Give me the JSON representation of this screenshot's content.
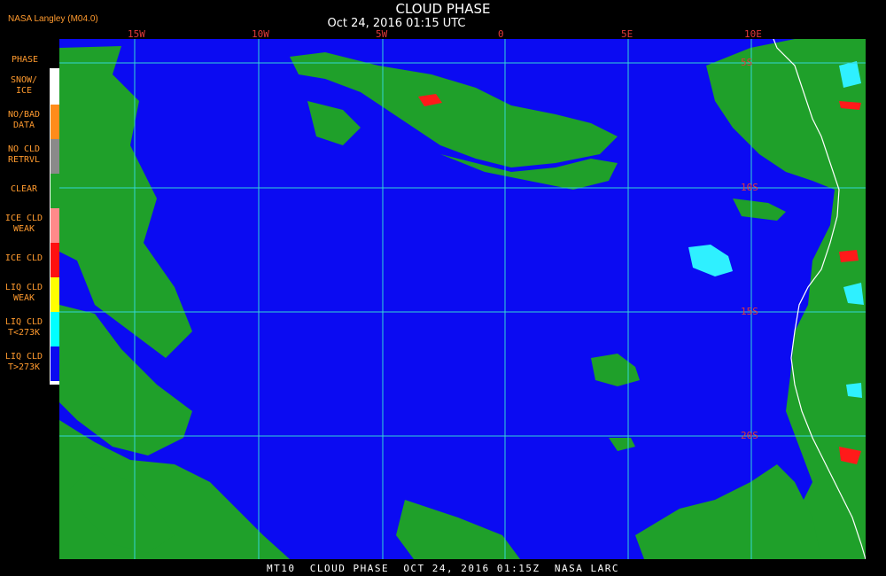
{
  "header": {
    "provider": "NASA Langley (M04.0)",
    "title": "CLOUD PHASE",
    "datetime": "Oct 24, 2016 01:15 UTC"
  },
  "legend": {
    "heading": "PHASE",
    "items": [
      {
        "label": "SNOW/\nICE",
        "color": "#ffffff"
      },
      {
        "label": "NO/BAD\nDATA",
        "color": "#ff8c1a"
      },
      {
        "label": "NO CLD\nRETRVL",
        "color": "#8a8a8a"
      },
      {
        "label": "CLEAR",
        "color": "#1fa02a"
      },
      {
        "label": "ICE CLD\nWEAK",
        "color": "#ff8a8a"
      },
      {
        "label": "ICE CLD",
        "color": "#ff1010"
      },
      {
        "label": "LIQ CLD\nWEAK",
        "color": "#ffff00"
      },
      {
        "label": "LIQ CLD\nT<273K",
        "color": "#00ffff"
      },
      {
        "label": "LIQ CLD\nT>273K",
        "color": "#0a0af0"
      }
    ]
  },
  "map": {
    "longitude_labels": [
      "15W",
      "10W",
      "5W",
      "0",
      "5E",
      "10E"
    ],
    "latitude_labels": [
      "5S",
      "10S",
      "15S",
      "20S"
    ],
    "colors": {
      "ocean_liquid_cloud": "#0b0bf2",
      "clear": "#1fa02a",
      "grid": "#33d6d6",
      "coastline": "#ffffff",
      "cold_liquid": "#2ff0ff",
      "ice": "#ff1a1a"
    }
  },
  "footer": {
    "text": "MT10  CLOUD PHASE  OCT 24, 2016 01:15Z  NASA LARC"
  }
}
